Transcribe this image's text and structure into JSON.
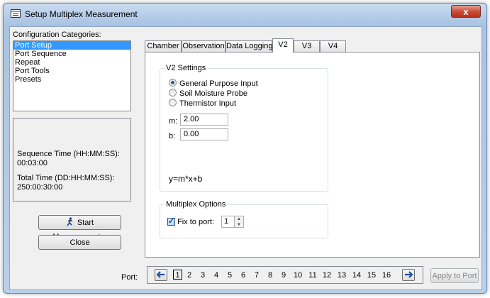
{
  "window": {
    "title": "Setup Multiplex Measurement",
    "close_glyph": "x"
  },
  "config": {
    "label": "Configuration Categories:",
    "items": [
      "Port Setup",
      "Port Sequence",
      "Repeat",
      "Port Tools",
      "Presets"
    ],
    "selected_index": 0
  },
  "info": {
    "sequence_label": "Sequence Time (HH:MM:SS):",
    "sequence_value": "00:03:00",
    "total_label": "Total Time (DD:HH:MM:SS):",
    "total_value": "250:00:30:00"
  },
  "buttons": {
    "start": "Start Measurement...",
    "close": "Close",
    "apply": "Apply to Port"
  },
  "tabs": [
    {
      "label": "Chamber",
      "active": false
    },
    {
      "label": "Observation",
      "active": false
    },
    {
      "label": "Data Logging",
      "active": false
    },
    {
      "label": "V2",
      "active": true
    },
    {
      "label": "V3",
      "active": false
    },
    {
      "label": "V4",
      "active": false
    }
  ],
  "settings": {
    "group_title": "V2 Settings",
    "options": [
      {
        "label": "General Purpose Input",
        "selected": true
      },
      {
        "label": "Soil Moisture Probe",
        "selected": false
      },
      {
        "label": "Thermistor Input",
        "selected": false
      }
    ],
    "m_label": "m:",
    "m_value": "2.00",
    "b_label": "b:",
    "b_value": "0.00",
    "equation": "y=m*x+b"
  },
  "multiplex": {
    "group_title": "Multiplex Options",
    "fix_label": "Fix to port:",
    "fix_checked": true,
    "fix_value": "1"
  },
  "ports": {
    "label": "Port:",
    "numbers": [
      "1",
      "2",
      "3",
      "4",
      "5",
      "6",
      "7",
      "8",
      "9",
      "10",
      "11",
      "12",
      "13",
      "14",
      "15",
      "16"
    ],
    "selected": "1",
    "prev_glyph": "🡄",
    "next_glyph": "🡆"
  },
  "colors": {
    "selection": "#3399ff",
    "title_gradient": "#c9dcf1",
    "close_button": "#c7503a"
  },
  "icons": {
    "title": "app-window-icon",
    "start": "running-person-icon",
    "prev": "arrow-left-icon",
    "next": "arrow-right-icon"
  }
}
